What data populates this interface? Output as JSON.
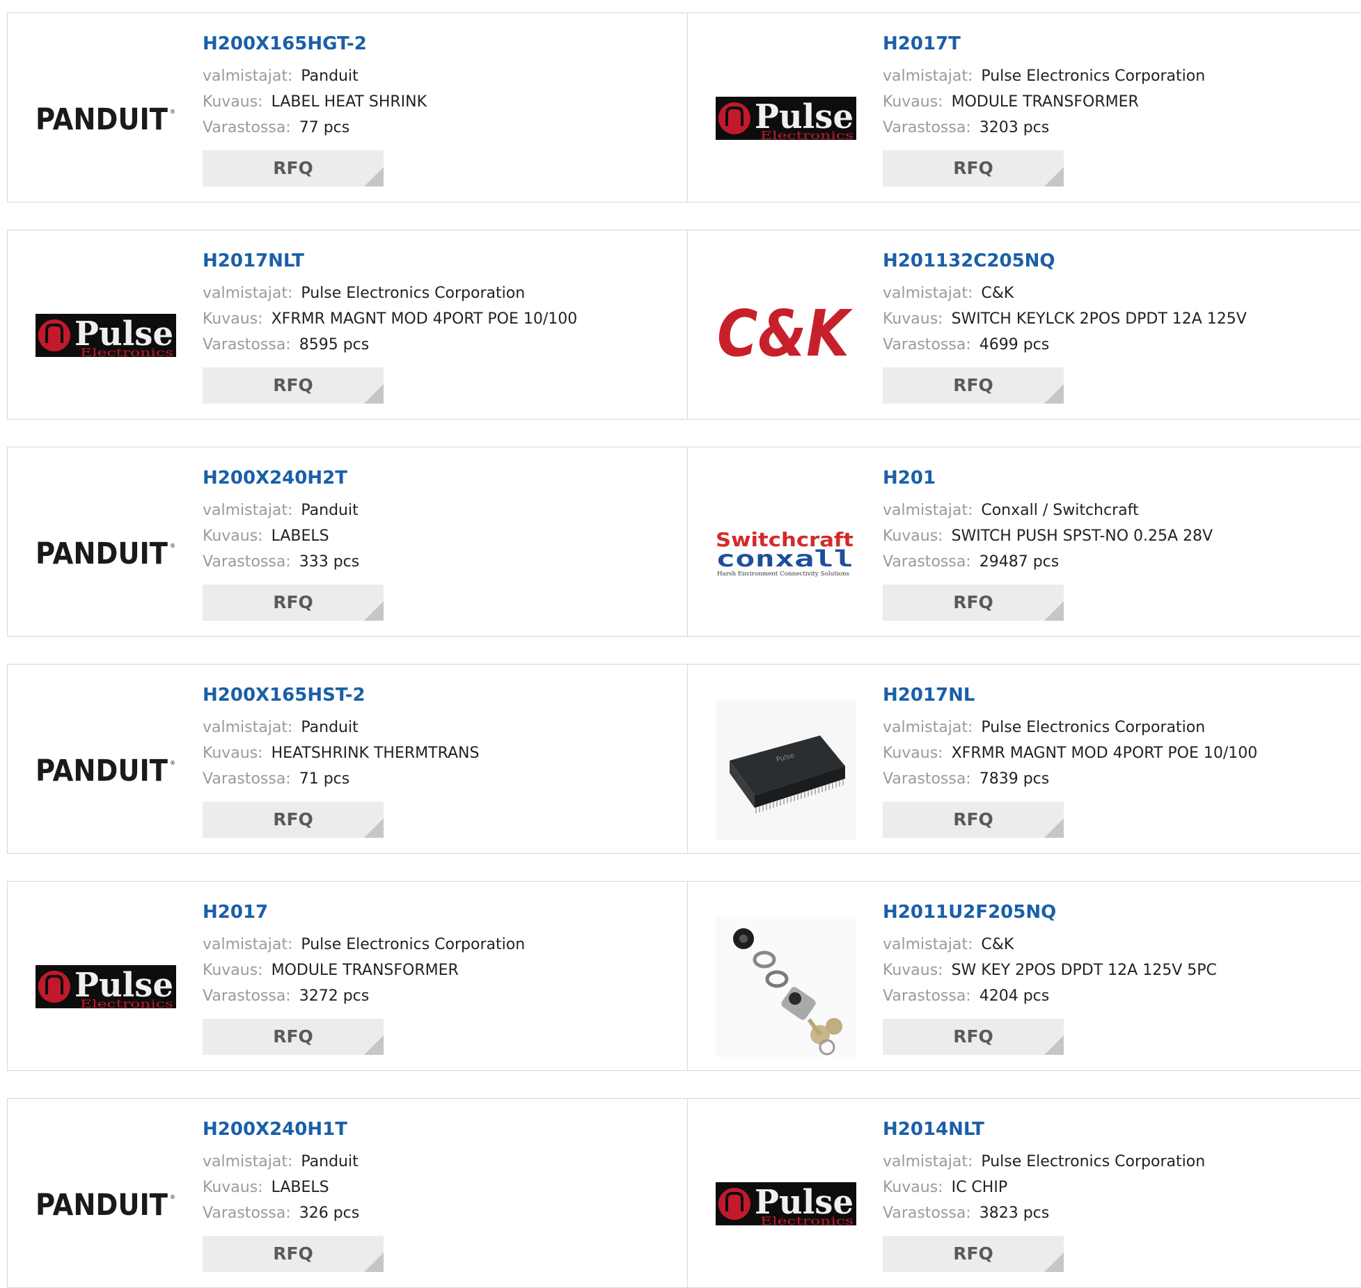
{
  "labels": {
    "manufacturer": "valmistajat:",
    "description": "Kuvaus:",
    "stock": "Varastossa:",
    "rfq": "RFQ"
  },
  "logos": {
    "panduit": "PANDUIT",
    "pulse": "Pulse",
    "pulse_sub": "Electronics",
    "ck": "C&K",
    "switchcraft": "Switchcraft",
    "conxall": "conxall",
    "conxall_sub": "Harsh Environment Connectivity Solutions",
    "chip_text": "Pulse"
  },
  "colors": {
    "link": "#1a5fa8",
    "rfq_bg": "#ececec",
    "border": "#d6d6d6",
    "ck_red": "#c8202a",
    "pulse_red": "#c2192b"
  },
  "rows": [
    {
      "left": {
        "part": "H200X165HGT-2",
        "manufacturer": "Panduit",
        "description": "LABEL HEAT SHRINK",
        "stock": "77 pcs",
        "logo": "panduit"
      },
      "right": {
        "part": "H2017T",
        "manufacturer": "Pulse Electronics Corporation",
        "description": "MODULE TRANSFORMER",
        "stock": "3203 pcs",
        "logo": "pulse"
      }
    },
    {
      "left": {
        "part": "H2017NLT",
        "manufacturer": "Pulse Electronics Corporation",
        "description": "XFRMR MAGNT MOD 4PORT POE 10/100",
        "stock": "8595 pcs",
        "logo": "pulse"
      },
      "right": {
        "part": "H201132C205NQ",
        "manufacturer": "C&K",
        "description": "SWITCH KEYLCK 2POS DPDT 12A 125V",
        "stock": "4699 pcs",
        "logo": "ck"
      }
    },
    {
      "left": {
        "part": "H200X240H2T",
        "manufacturer": "Panduit",
        "description": "LABELS",
        "stock": "333 pcs",
        "logo": "panduit"
      },
      "right": {
        "part": "H201",
        "manufacturer": "Conxall / Switchcraft",
        "description": "SWITCH PUSH SPST-NO 0.25A 28V",
        "stock": "29487 pcs",
        "logo": "switchcraft"
      }
    },
    {
      "left": {
        "part": "H200X165HST-2",
        "manufacturer": "Panduit",
        "description": "HEATSHRINK THERMTRANS",
        "stock": "71 pcs",
        "logo": "panduit"
      },
      "right": {
        "part": "H2017NL",
        "manufacturer": "Pulse Electronics Corporation",
        "description": "XFRMR MAGNT MOD 4PORT POE 10/100",
        "stock": "7839 pcs",
        "logo": "chip"
      }
    },
    {
      "left": {
        "part": "H2017",
        "manufacturer": "Pulse Electronics Corporation",
        "description": "MODULE TRANSFORMER",
        "stock": "3272 pcs",
        "logo": "pulse"
      },
      "right": {
        "part": "H2011U2F205NQ",
        "manufacturer": "C&K",
        "description": "SW KEY 2POS DPDT 12A 125V 5PC",
        "stock": "4204 pcs",
        "logo": "keyswitch"
      }
    },
    {
      "left": {
        "part": "H200X240H1T",
        "manufacturer": "Panduit",
        "description": "LABELS",
        "stock": "326 pcs",
        "logo": "panduit"
      },
      "right": {
        "part": "H2014NLT",
        "manufacturer": "Pulse Electronics Corporation",
        "description": "IC CHIP",
        "stock": "3823 pcs",
        "logo": "pulse"
      }
    }
  ]
}
